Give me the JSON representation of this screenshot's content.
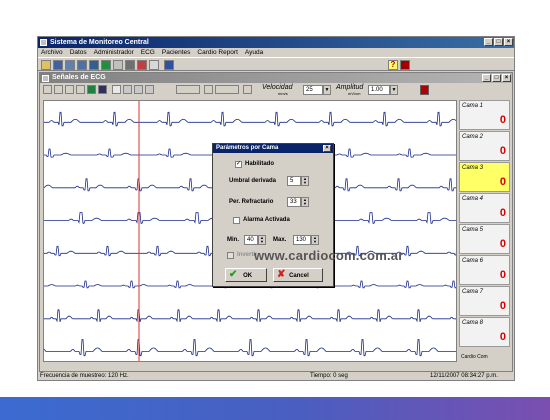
{
  "app": {
    "title": "Sistema de Monitoreo Central",
    "menu": [
      "Archivo",
      "Datos",
      "Administrador",
      "ECG",
      "Pacientes",
      "Cardio Report",
      "Ayuda"
    ],
    "help_symbol": "?"
  },
  "ecg_window": {
    "title": "Señales de ECG",
    "speed_label": "Velocidad",
    "speed_unit": "mm/s",
    "speed_value": "25",
    "amplitude_label": "Amplitud",
    "amplitude_unit": "mV/cm",
    "amplitude_value": "1.00"
  },
  "beds": [
    {
      "name": "Cama 1",
      "value": "0",
      "active": false
    },
    {
      "name": "Cama 2",
      "value": "0",
      "active": false
    },
    {
      "name": "Cama 3",
      "value": "0",
      "active": true
    },
    {
      "name": "Cama 4",
      "value": "0",
      "active": false
    },
    {
      "name": "Cama 5",
      "value": "0",
      "active": false
    },
    {
      "name": "Cama 6",
      "value": "0",
      "active": false
    },
    {
      "name": "Cama 7",
      "value": "0",
      "active": false
    },
    {
      "name": "Cama 8",
      "value": "0",
      "active": false
    }
  ],
  "beds_footer": "Cardio Com",
  "status": {
    "sample_rate": "Frecuencia de muestreo: 120 Hz.",
    "time": "Tiempo: 0 seg",
    "datetime": "12/11/2007 08:34:27 p.m."
  },
  "dialog": {
    "title": "Parámetros por Cama",
    "enabled_label": "Habilitado",
    "enabled_checked": true,
    "threshold_label": "Umbral derivada",
    "threshold_value": "5",
    "refractory_label": "Per. Refractario",
    "refractory_value": "33",
    "alarm_label": "Alarma Activada",
    "alarm_checked": false,
    "min_label": "Min.",
    "min_value": "40",
    "max_label": "Max.",
    "max_value": "130",
    "invert_label": "Invertir",
    "invert_checked": false,
    "ok_label": "OK",
    "cancel_label": "Cancel"
  },
  "watermark": "www.cardiocom.com.ar",
  "colors": {
    "titlebar": "#0a246a",
    "ecg_trace": "#1a2a8a",
    "cursor_line": "#e03030",
    "bed_value": "#d60000",
    "active_bed": "#ffff66"
  }
}
